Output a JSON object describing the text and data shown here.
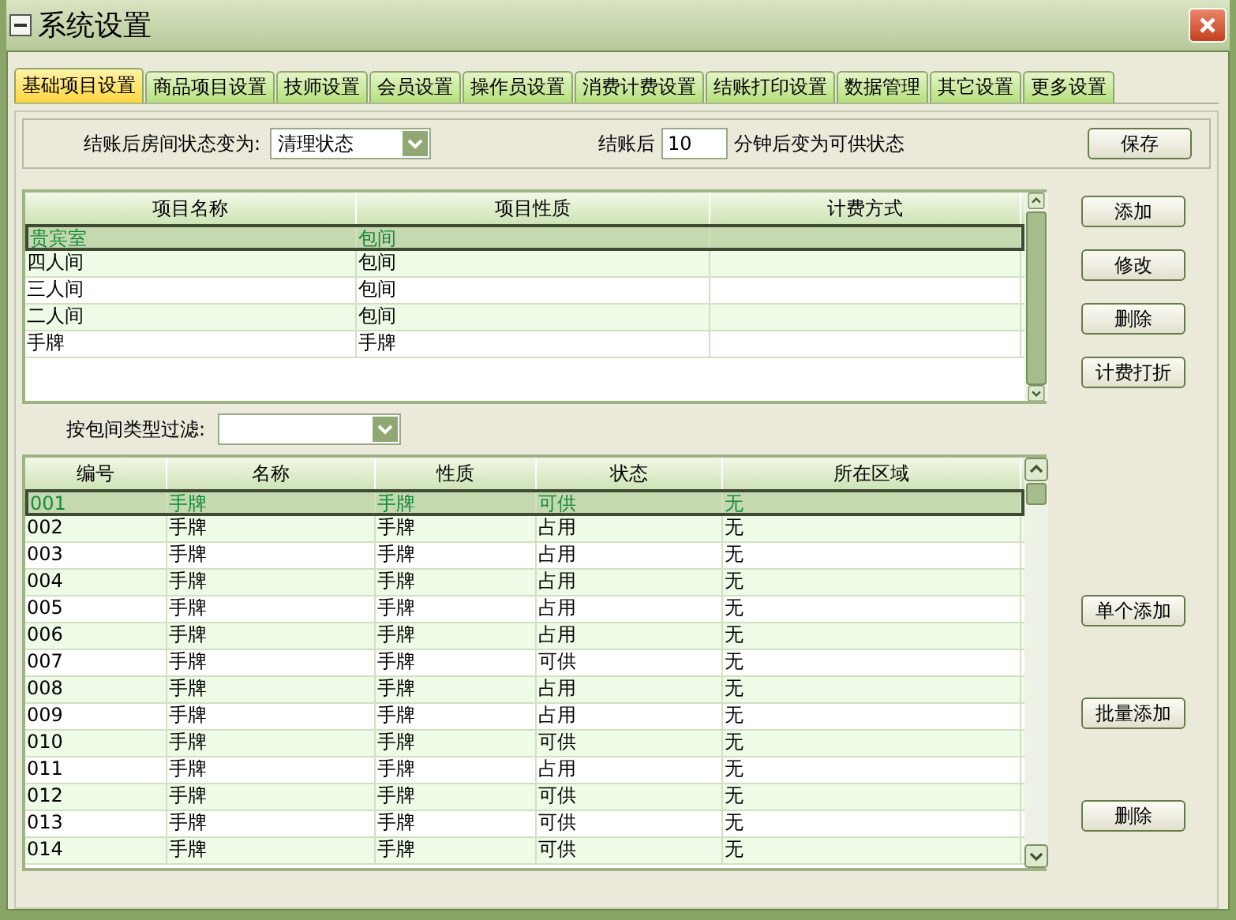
{
  "window": {
    "title": "系统设置"
  },
  "tabs": [
    {
      "label": "基础项目设置",
      "selected": true
    },
    {
      "label": "商品项目设置",
      "selected": false
    },
    {
      "label": "技师设置",
      "selected": false
    },
    {
      "label": "会员设置",
      "selected": false
    },
    {
      "label": "操作员设置",
      "selected": false
    },
    {
      "label": "消费计费设置",
      "selected": false
    },
    {
      "label": "结账打印设置",
      "selected": false
    },
    {
      "label": "数据管理",
      "selected": false
    },
    {
      "label": "其它设置",
      "selected": false
    },
    {
      "label": "更多设置",
      "selected": false
    }
  ],
  "settings": {
    "status_label": "结账后房间状态变为:",
    "status_value": "清理状态",
    "after_label": "结账后",
    "minutes_value": "10",
    "minutes_suffix": "分钟后变为可供状态",
    "save_button": "保存"
  },
  "items_table": {
    "columns": [
      "项目名称",
      "项目性质",
      "计费方式"
    ],
    "rows": [
      {
        "cells": [
          "贵宾室",
          "包间",
          ""
        ],
        "selected": true
      },
      {
        "cells": [
          "四人间",
          "包间",
          ""
        ],
        "selected": false
      },
      {
        "cells": [
          "三人间",
          "包间",
          ""
        ],
        "selected": false
      },
      {
        "cells": [
          "二人间",
          "包间",
          ""
        ],
        "selected": false
      },
      {
        "cells": [
          "手牌",
          "手牌",
          ""
        ],
        "selected": false
      }
    ]
  },
  "item_buttons": [
    "添加",
    "修改",
    "删除",
    "计费打折"
  ],
  "filter": {
    "label": "按包间类型过滤:"
  },
  "rooms_table": {
    "columns": [
      "编号",
      "名称",
      "性质",
      "状态",
      "所在区域"
    ],
    "rows": [
      {
        "cells": [
          "001",
          "手牌",
          "手牌",
          "可供",
          "无"
        ],
        "selected": true
      },
      {
        "cells": [
          "002",
          "手牌",
          "手牌",
          "占用",
          "无"
        ],
        "selected": false
      },
      {
        "cells": [
          "003",
          "手牌",
          "手牌",
          "占用",
          "无"
        ],
        "selected": false
      },
      {
        "cells": [
          "004",
          "手牌",
          "手牌",
          "占用",
          "无"
        ],
        "selected": false
      },
      {
        "cells": [
          "005",
          "手牌",
          "手牌",
          "占用",
          "无"
        ],
        "selected": false
      },
      {
        "cells": [
          "006",
          "手牌",
          "手牌",
          "占用",
          "无"
        ],
        "selected": false
      },
      {
        "cells": [
          "007",
          "手牌",
          "手牌",
          "可供",
          "无"
        ],
        "selected": false
      },
      {
        "cells": [
          "008",
          "手牌",
          "手牌",
          "占用",
          "无"
        ],
        "selected": false
      },
      {
        "cells": [
          "009",
          "手牌",
          "手牌",
          "占用",
          "无"
        ],
        "selected": false
      },
      {
        "cells": [
          "010",
          "手牌",
          "手牌",
          "可供",
          "无"
        ],
        "selected": false
      },
      {
        "cells": [
          "011",
          "手牌",
          "手牌",
          "占用",
          "无"
        ],
        "selected": false
      },
      {
        "cells": [
          "012",
          "手牌",
          "手牌",
          "可供",
          "无"
        ],
        "selected": false
      },
      {
        "cells": [
          "013",
          "手牌",
          "手牌",
          "可供",
          "无"
        ],
        "selected": false
      },
      {
        "cells": [
          "014",
          "手牌",
          "手牌",
          "可供",
          "无"
        ],
        "selected": false
      }
    ]
  },
  "room_buttons": [
    "单个添加",
    "批量添加",
    "删除"
  ]
}
